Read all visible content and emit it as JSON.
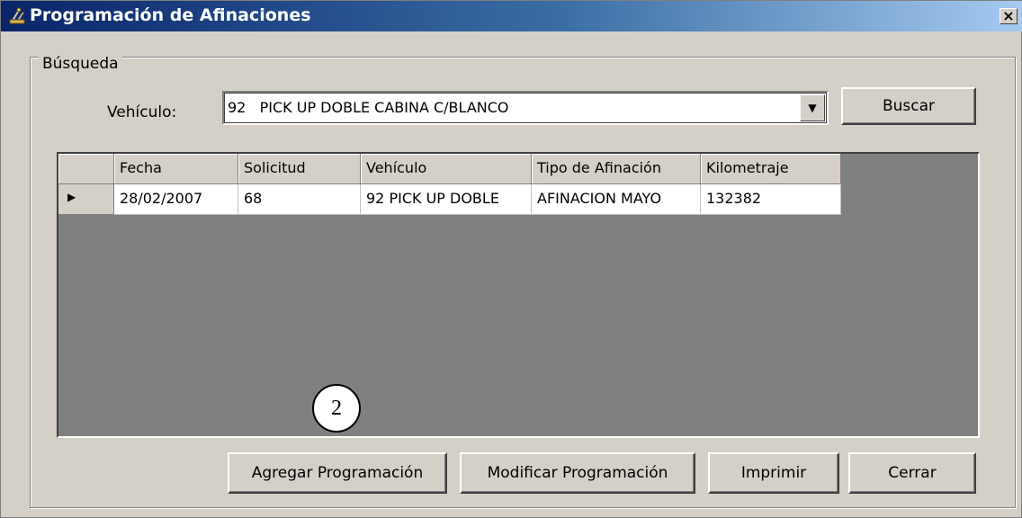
{
  "window": {
    "title": "Programación de Afinaciones",
    "close_glyph": "×"
  },
  "search": {
    "group_label": "Búsqueda",
    "vehicle_label": "Vehículo:",
    "vehicle_value": "92   PICK UP DOBLE CABINA C/BLANCO",
    "dropdown_arrow": "▼",
    "search_button": "Buscar"
  },
  "grid": {
    "columns": [
      "Fecha",
      "Solicitud",
      "Vehículo",
      "Tipo de Afinación",
      "Kilometraje"
    ],
    "rows": [
      {
        "indicator": "▶",
        "cells": [
          "28/02/2007",
          "68",
          "92 PICK UP DOBLE",
          "AFINACION MAYO",
          "132382"
        ]
      }
    ]
  },
  "footer": {
    "add_button": "Agregar Programación",
    "modify_button": "Modificar Programación",
    "print_button": "Imprimir",
    "close_button": "Cerrar"
  },
  "annotation": {
    "callout_number": "2"
  },
  "colors": {
    "title_gradient_start": "#0a246a",
    "title_gradient_end": "#a6caf0",
    "window_face": "#d4d0c8",
    "grid_background": "#808080"
  },
  "icons": {
    "title_icon": "wrench-tool-icon"
  }
}
